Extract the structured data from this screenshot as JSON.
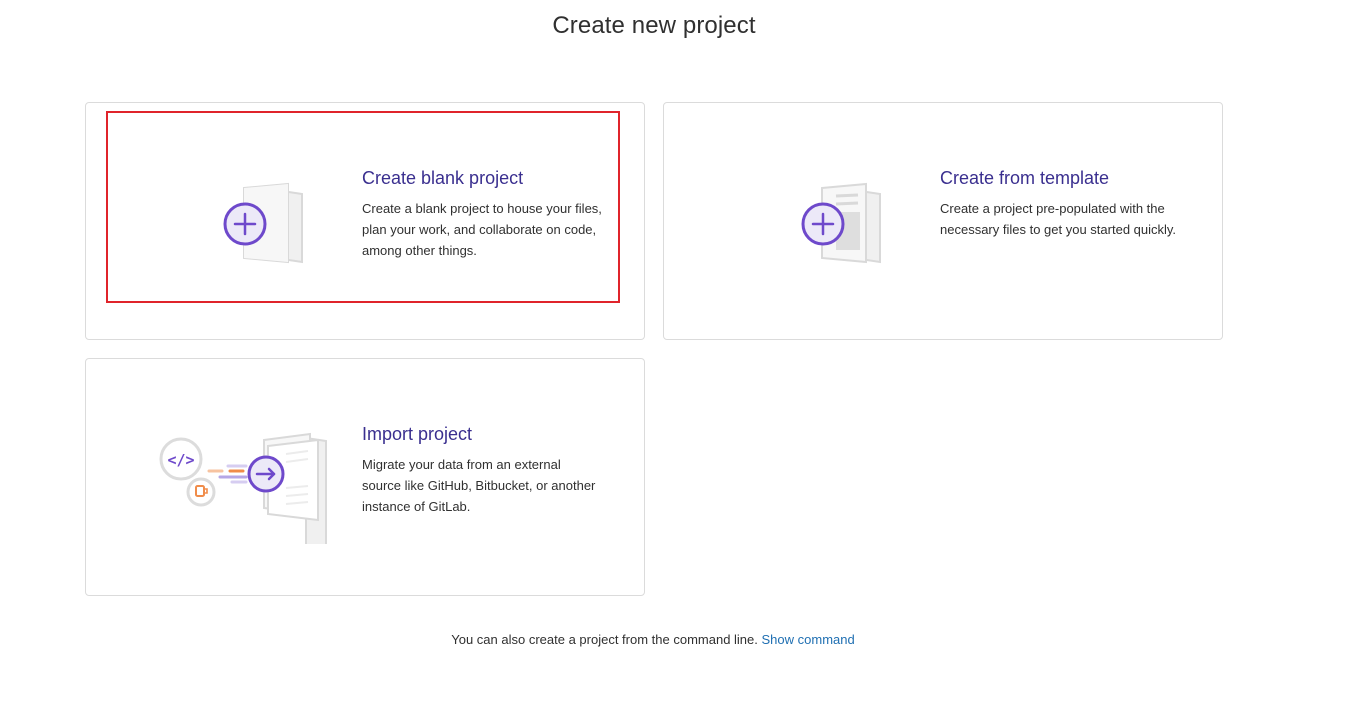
{
  "page": {
    "title": "Create new project"
  },
  "cards": {
    "blank": {
      "title": "Create blank project",
      "description": "Create a blank project to house your files, plan your work, and collaborate on code, among other things.",
      "icon": "blank-project-illustration"
    },
    "template": {
      "title": "Create from template",
      "description": "Create a project pre-populated with the necessary files to get you started quickly.",
      "icon": "template-project-illustration"
    },
    "import": {
      "title": "Import project",
      "description": "Migrate your data from an external source like GitHub, Bitbucket, or another instance of GitLab.",
      "icon": "import-project-illustration"
    }
  },
  "footer": {
    "text": "You can also create a project from the command line.",
    "link_label": "Show command"
  },
  "colors": {
    "accent": "#6e49cb",
    "title": "#3a2f8f",
    "link": "#1f6fb2",
    "highlight": "#e0242b",
    "border": "#dbdbdb"
  }
}
